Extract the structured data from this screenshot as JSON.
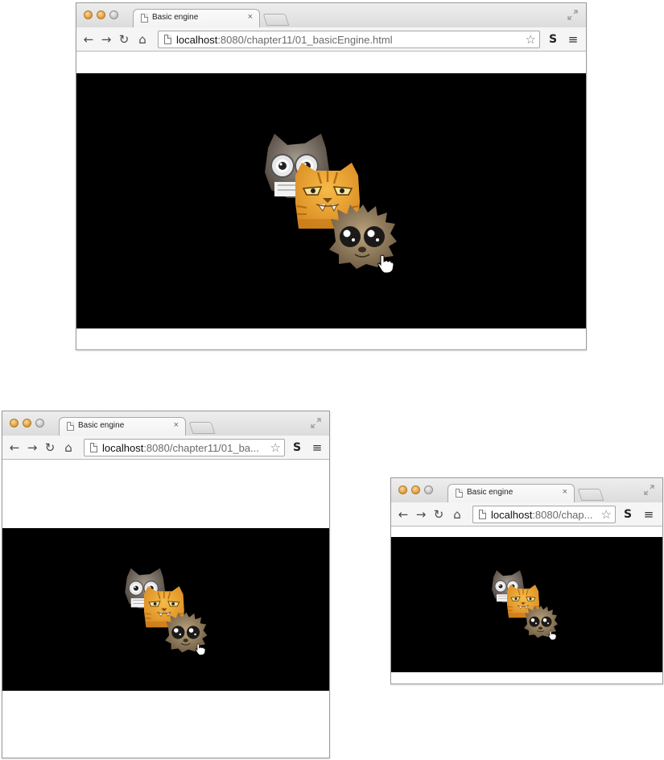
{
  "windows": [
    {
      "tab_title": "Basic engine",
      "url_host": "localhost",
      "url_path": ":8080/chapter11/01_basicEngine.html"
    },
    {
      "tab_title": "Basic engine",
      "url_host": "localhost",
      "url_path": ":8080/chapter11/01_ba..."
    },
    {
      "tab_title": "Basic engine",
      "url_host": "localhost",
      "url_path": ":8080/chap..."
    }
  ],
  "icons": {
    "back": "←",
    "forward": "→",
    "reload": "↻",
    "home": "⌂",
    "star": "☆",
    "menu": "≡",
    "close": "×"
  },
  "colors": {
    "canvas": "#000000",
    "traffic_light": "#e09e35",
    "cat": "#e9a235",
    "owl": "#6b6158",
    "hedgehog": "#8c7658"
  }
}
